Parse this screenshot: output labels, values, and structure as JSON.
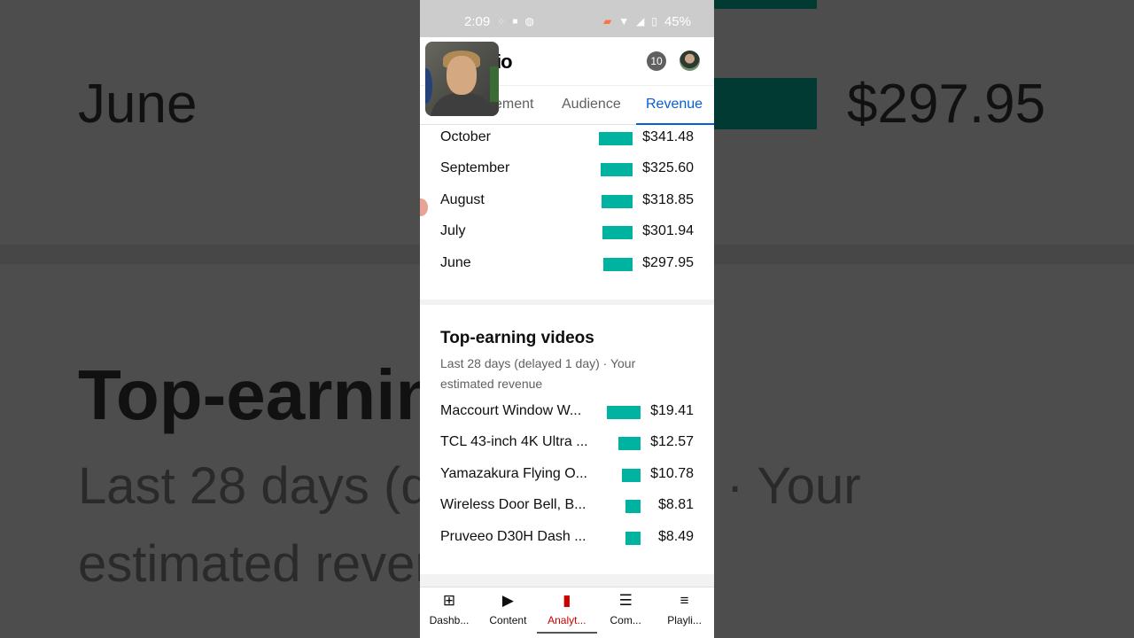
{
  "status_bar": {
    "time": "2:09",
    "battery": "45%"
  },
  "app": {
    "title_visible": "io",
    "notification_count": "10"
  },
  "tabs": [
    {
      "label": "ement",
      "active": false
    },
    {
      "label": "Audience",
      "active": false
    },
    {
      "label": "Revenue",
      "active": true
    }
  ],
  "monthly_revenue": {
    "rows": [
      {
        "label": "October",
        "value": "$341.48",
        "amount": 341.48
      },
      {
        "label": "September",
        "value": "$325.60",
        "amount": 325.6
      },
      {
        "label": "August",
        "value": "$318.85",
        "amount": 318.85
      },
      {
        "label": "July",
        "value": "$301.94",
        "amount": 301.94
      },
      {
        "label": "June",
        "value": "$297.95",
        "amount": 297.95
      }
    ]
  },
  "top_earning": {
    "title": "Top-earning videos",
    "subtitle": "Last 28 days (delayed 1 day) · Your estimated revenue",
    "rows": [
      {
        "label": "Maccourt Window W...",
        "value": "$19.41",
        "amount": 19.41
      },
      {
        "label": "TCL 43-inch 4K Ultra ...",
        "value": "$12.57",
        "amount": 12.57
      },
      {
        "label": "Yamazakura Flying O...",
        "value": "$10.78",
        "amount": 10.78
      },
      {
        "label": "Wireless Door Bell, B...",
        "value": "$8.81",
        "amount": 8.81
      },
      {
        "label": "Pruveeo D30H Dash ...",
        "value": "$8.49",
        "amount": 8.49
      }
    ]
  },
  "bottom_nav": [
    {
      "label": "Dashb...",
      "icon": "dashboard-icon",
      "active": false
    },
    {
      "label": "Content",
      "icon": "content-icon",
      "active": false
    },
    {
      "label": "Analyt...",
      "icon": "analytics-icon",
      "active": true
    },
    {
      "label": "Com...",
      "icon": "comments-icon",
      "active": false
    },
    {
      "label": "Playli...",
      "icon": "playlist-icon",
      "active": false
    }
  ],
  "background": {
    "left_month": "June",
    "right_value": "$297.95",
    "left_title": "Top-earnin",
    "left_sub1": "Last 28 days (d",
    "right_sub1": "· Your",
    "left_sub2": "estimated rever"
  }
}
